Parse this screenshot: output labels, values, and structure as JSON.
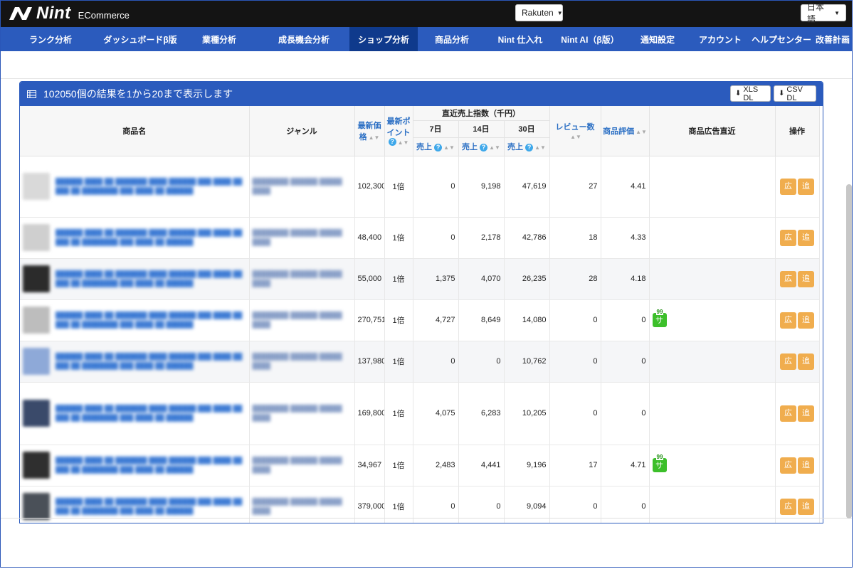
{
  "header": {
    "brand": "Nint",
    "sub_brand": "ECommerce",
    "market_select": "Rakuten",
    "language_select": "日本語"
  },
  "nav": {
    "items": [
      {
        "label": "ランク分析"
      },
      {
        "label": "ダッシュボードβ版"
      },
      {
        "label": "業種分析"
      },
      {
        "label": "成長機会分析"
      },
      {
        "label": "ショップ分析"
      },
      {
        "label": "商品分析"
      },
      {
        "label": "Nint 仕入れ"
      },
      {
        "label": "Nint AI（β版）"
      },
      {
        "label": "通知設定"
      },
      {
        "label": "アカウント"
      },
      {
        "label": "ヘルプセンター"
      },
      {
        "label": "改善計画"
      }
    ],
    "active_index": 4
  },
  "panel": {
    "title": "102050個の結果を1から20まで表示します",
    "xls_label": "XLS DL",
    "csv_label": "CSV DL"
  },
  "table": {
    "headers": {
      "product": "商品名",
      "genre": "ジャンル",
      "price": "最新価格",
      "point": "最新ポイント",
      "recent_sales": "直近売上指数（千円）",
      "d7": "7日",
      "d14": "14日",
      "d30": "30日",
      "sales": "売上",
      "reviews": "レビュー数",
      "rating": "商品評価",
      "ads": "商品広告直近",
      "ops": "操作"
    },
    "action_ad": "広",
    "action_track": "追",
    "badge_number": "99",
    "badge_letter": "サ",
    "rows": [
      {
        "price": "102,300",
        "point": "1倍",
        "s7": "0",
        "s14": "9,198",
        "s30": "47,619",
        "reviews": "27",
        "rating": "4.41",
        "ad": false
      },
      {
        "price": "48,400",
        "point": "1倍",
        "s7": "0",
        "s14": "2,178",
        "s30": "42,786",
        "reviews": "18",
        "rating": "4.33",
        "ad": false
      },
      {
        "price": "55,000",
        "point": "1倍",
        "s7": "1,375",
        "s14": "4,070",
        "s30": "26,235",
        "reviews": "28",
        "rating": "4.18",
        "ad": false
      },
      {
        "price": "270,751",
        "point": "1倍",
        "s7": "4,727",
        "s14": "8,649",
        "s30": "14,080",
        "reviews": "0",
        "rating": "0",
        "ad": true
      },
      {
        "price": "137,980",
        "point": "1倍",
        "s7": "0",
        "s14": "0",
        "s30": "10,762",
        "reviews": "0",
        "rating": "0",
        "ad": false
      },
      {
        "price": "169,800",
        "point": "1倍",
        "s7": "4,075",
        "s14": "6,283",
        "s30": "10,205",
        "reviews": "0",
        "rating": "0",
        "ad": false
      },
      {
        "price": "34,967",
        "point": "1倍",
        "s7": "2,483",
        "s14": "4,441",
        "s30": "9,196",
        "reviews": "17",
        "rating": "4.71",
        "ad": true
      },
      {
        "price": "379,000",
        "point": "1倍",
        "s7": "0",
        "s14": "0",
        "s30": "9,094",
        "reviews": "0",
        "rating": "0",
        "ad": false
      }
    ]
  }
}
